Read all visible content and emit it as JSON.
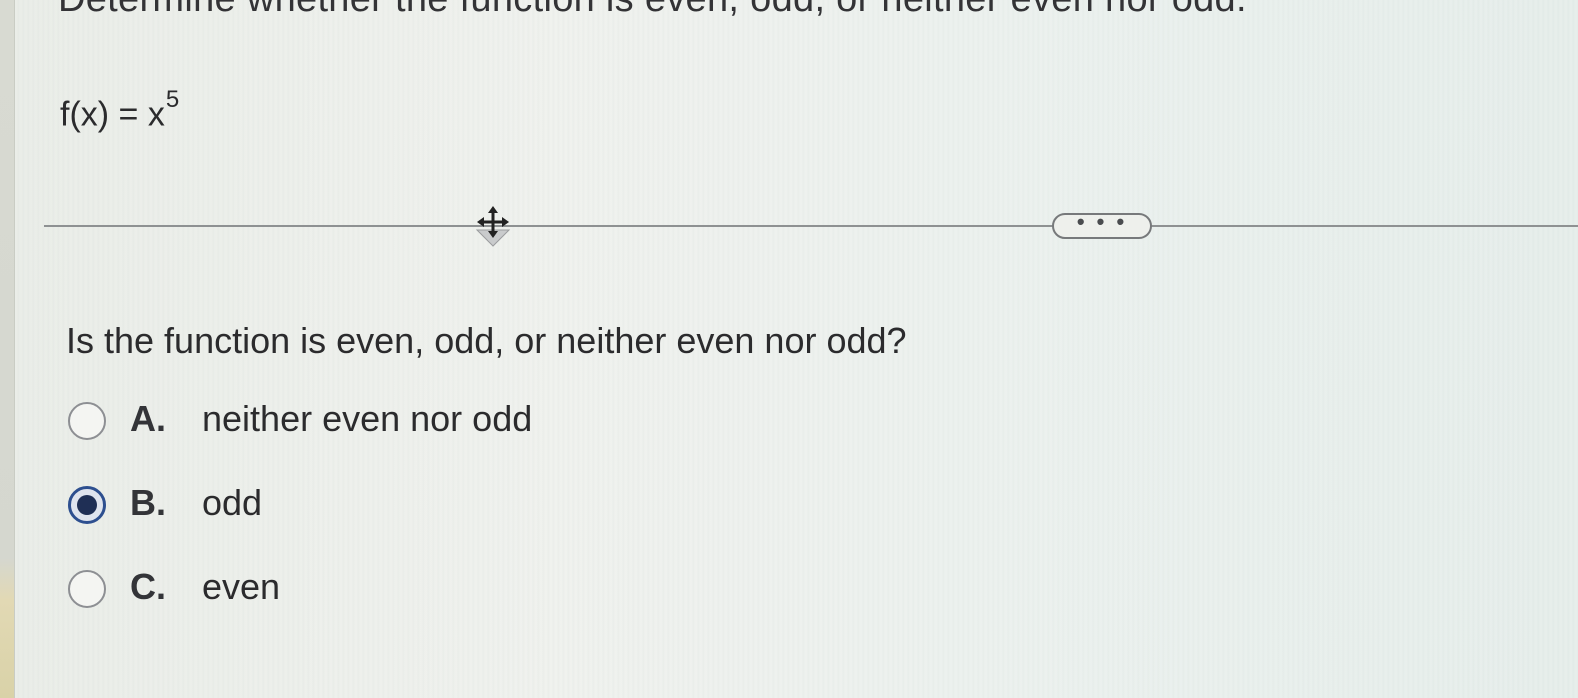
{
  "instruction": "Determine whether the function is even, odd, or neither even nor odd.",
  "formula": {
    "base": "f(x) = x",
    "exponent": "5"
  },
  "divider": {
    "more_label": "• • •"
  },
  "question": "Is the function is even, odd, or neither even nor odd?",
  "options": [
    {
      "letter": "A.",
      "text": "neither even nor odd",
      "selected": false
    },
    {
      "letter": "B.",
      "text": "odd",
      "selected": true
    },
    {
      "letter": "C.",
      "text": "even",
      "selected": false
    }
  ],
  "colors": {
    "selected_radio": "#2d4f8f",
    "text": "#2b2b2d"
  }
}
